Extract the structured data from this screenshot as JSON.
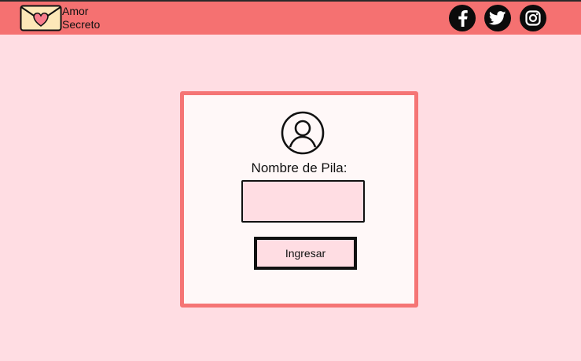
{
  "header": {
    "brand_line1": "Amor",
    "brand_line2": "Secreto",
    "logo_icon": "envelope-heart-icon",
    "social": [
      {
        "name": "facebook-icon"
      },
      {
        "name": "twitter-icon"
      },
      {
        "name": "instagram-icon"
      }
    ]
  },
  "login": {
    "user_icon": "user-circle-icon",
    "label": "Nombre de Pila:",
    "input_value": "",
    "submit_label": "Ingresar"
  },
  "colors": {
    "header": "#f57171",
    "background": "#ffdde3",
    "card_border": "#f57575",
    "card_bg": "#fff8f8"
  }
}
